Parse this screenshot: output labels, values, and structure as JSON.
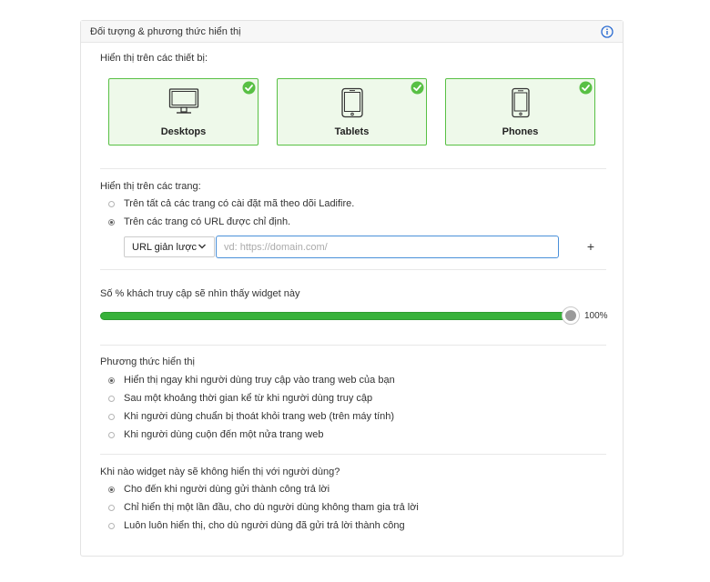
{
  "header": {
    "title": "Đối tượng & phương thức hiển thị",
    "info_icon": "info-icon"
  },
  "devices": {
    "label": "Hiển thị trên các thiết bị:",
    "items": [
      {
        "label": "Desktops",
        "icon": "desktop-icon",
        "selected": true
      },
      {
        "label": "Tablets",
        "icon": "tablet-icon",
        "selected": true
      },
      {
        "label": "Phones",
        "icon": "phone-icon",
        "selected": true
      }
    ],
    "accent": "#58c044",
    "card_bg": "#eef9ea"
  },
  "pages": {
    "label": "Hiển thị trên các trang:",
    "options": [
      {
        "label": "Trên tất cả các trang có cài đặt mã theo dõi Ladifire.",
        "checked": false
      },
      {
        "label": "Trên các trang có URL được chỉ định.",
        "checked": true
      }
    ],
    "url_mode": "URL giản lược",
    "url_placeholder": "vd: https://domain.com/",
    "url_value": "",
    "add_label": "+"
  },
  "audience": {
    "label": "Số % khách truy cập sẽ nhìn thấy widget này",
    "percent": 100,
    "value_text": "100%",
    "slider_color": "#38b23b"
  },
  "display_method": {
    "label": "Phương thức hiển thị",
    "options": [
      {
        "label": "Hiển thị ngay khi người dùng truy cập vào trang web của bạn",
        "checked": true
      },
      {
        "label": "Sau một khoảng thời gian kể từ khi người dùng truy cập",
        "checked": false
      },
      {
        "label": "Khi người dùng chuẩn bị thoát khỏi trang web (trên máy tính)",
        "checked": false
      },
      {
        "label": "Khi người dùng cuộn đến một nửa trang web",
        "checked": false
      }
    ]
  },
  "hide_when": {
    "label": "Khi nào widget này sẽ không hiển thị với người dùng?",
    "options": [
      {
        "label": "Cho đến khi người dùng gửi thành công trả lời",
        "checked": true
      },
      {
        "label": "Chỉ hiển thị một lần đầu, cho dù người dùng không tham gia trả lời",
        "checked": false
      },
      {
        "label": "Luôn luôn hiển thị, cho dù người dùng đã gửi trả lời thành công",
        "checked": false
      }
    ]
  }
}
